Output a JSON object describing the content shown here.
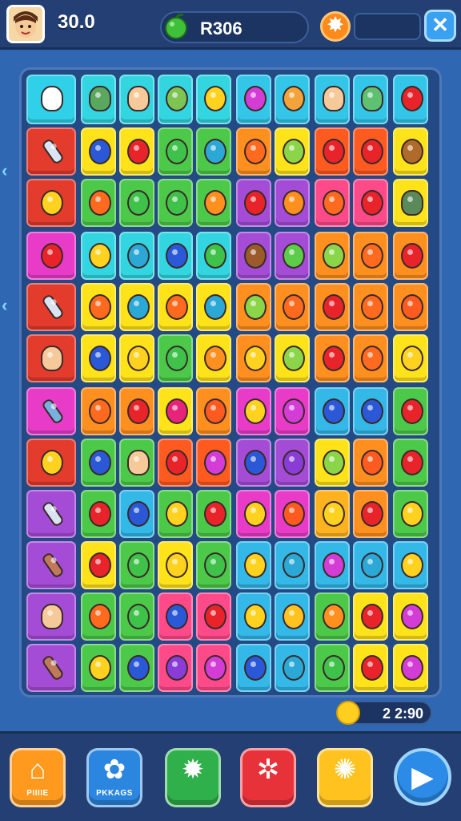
{
  "header": {
    "score": "30.0",
    "gem_label": "R306",
    "coin_symbol": "✸",
    "close_symbol": "✕"
  },
  "board": {
    "arrows": [
      "‹",
      "‹"
    ],
    "rows": [
      {
        "tiles": [
          {
            "bg": "#2fd0e8",
            "fruit": "#ffffff",
            "kind": "head"
          },
          {
            "bg": "#33d6e0",
            "fruit": "#5aa860",
            "kind": "head"
          },
          {
            "bg": "#33d6e0",
            "fruit": "#f6c99a",
            "kind": "head"
          },
          {
            "bg": "#33d6e0",
            "fruit": "#7cc453",
            "kind": "fruit"
          },
          {
            "bg": "#33d6e0",
            "fruit": "#ffd21f",
            "kind": "fruit"
          },
          {
            "bg": "#33c6e8",
            "fruit": "#d43cd6",
            "kind": "fruit"
          },
          {
            "bg": "#33c6e8",
            "fruit": "#f2a33a",
            "kind": "fruit"
          },
          {
            "bg": "#33c6e8",
            "fruit": "#f6c99a",
            "kind": "head"
          },
          {
            "bg": "#33c6e8",
            "fruit": "#5fc072",
            "kind": "head"
          },
          {
            "bg": "#33c6e8",
            "fruit": "#e8242a",
            "kind": "fruit"
          }
        ]
      },
      {
        "tiles": [
          {
            "bg": "#e33b2c",
            "fruit": "#d9e4f0",
            "kind": "tool"
          },
          {
            "bg": "#ffe31a",
            "fruit": "#2b58d6",
            "kind": "fruit"
          },
          {
            "bg": "#ffe31a",
            "fruit": "#e8242a",
            "kind": "fruit"
          },
          {
            "bg": "#4dc94a",
            "fruit": "#3fc24a",
            "kind": "fruit"
          },
          {
            "bg": "#4dc94a",
            "fruit": "#2ba8d6",
            "kind": "fruit"
          },
          {
            "bg": "#ff8f1f",
            "fruit": "#ff6a1f",
            "kind": "fruit"
          },
          {
            "bg": "#ffe31a",
            "fruit": "#8ad648",
            "kind": "fruit"
          },
          {
            "bg": "#ff5a1f",
            "fruit": "#e8242a",
            "kind": "fruit"
          },
          {
            "bg": "#ff5a1f",
            "fruit": "#e8242a",
            "kind": "fruit"
          },
          {
            "bg": "#ffe31a",
            "fruit": "#b06a2a",
            "kind": "fruit"
          }
        ]
      },
      {
        "tiles": [
          {
            "bg": "#e33b2c",
            "fruit": "#ffd21f",
            "kind": "fruit"
          },
          {
            "bg": "#4dc94a",
            "fruit": "#ff6a1f",
            "kind": "fruit"
          },
          {
            "bg": "#4dc94a",
            "fruit": "#3fc24a",
            "kind": "fruit"
          },
          {
            "bg": "#4dc94a",
            "fruit": "#3fc24a",
            "kind": "fruit"
          },
          {
            "bg": "#4dc94a",
            "fruit": "#ff8f1f",
            "kind": "fruit"
          },
          {
            "bg": "#a54cd6",
            "fruit": "#e8242a",
            "kind": "fruit"
          },
          {
            "bg": "#a54cd6",
            "fruit": "#ff8f1f",
            "kind": "fruit"
          },
          {
            "bg": "#ff4a8a",
            "fruit": "#ff6a1f",
            "kind": "fruit"
          },
          {
            "bg": "#ff4a8a",
            "fruit": "#e8242a",
            "kind": "fruit"
          },
          {
            "bg": "#ffe31a",
            "fruit": "#5a8a5a",
            "kind": "head"
          }
        ]
      },
      {
        "tiles": [
          {
            "bg": "#e83cc8",
            "fruit": "#e8242a",
            "kind": "fruit"
          },
          {
            "bg": "#33d6e0",
            "fruit": "#ffd21f",
            "kind": "fruit"
          },
          {
            "bg": "#33d6e0",
            "fruit": "#2ba8d6",
            "kind": "fruit"
          },
          {
            "bg": "#33d6e0",
            "fruit": "#2b58d6",
            "kind": "fruit"
          },
          {
            "bg": "#33d6e0",
            "fruit": "#3fc24a",
            "kind": "fruit"
          },
          {
            "bg": "#a54cd6",
            "fruit": "#9a5a2a",
            "kind": "fruit"
          },
          {
            "bg": "#a54cd6",
            "fruit": "#5ccc4a",
            "kind": "fruit"
          },
          {
            "bg": "#ff8f1f",
            "fruit": "#8ad648",
            "kind": "fruit"
          },
          {
            "bg": "#ff8f1f",
            "fruit": "#ff6a1f",
            "kind": "fruit"
          },
          {
            "bg": "#ff8f1f",
            "fruit": "#e8242a",
            "kind": "fruit"
          }
        ]
      },
      {
        "tiles": [
          {
            "bg": "#e33b2c",
            "fruit": "#d9e4f0",
            "kind": "tool"
          },
          {
            "bg": "#ffe31a",
            "fruit": "#ff6a1f",
            "kind": "fruit"
          },
          {
            "bg": "#ffe31a",
            "fruit": "#2ba8d6",
            "kind": "fruit"
          },
          {
            "bg": "#ffe31a",
            "fruit": "#ff6a1f",
            "kind": "fruit"
          },
          {
            "bg": "#ffe31a",
            "fruit": "#2ba8d6",
            "kind": "fruit"
          },
          {
            "bg": "#ff8f1f",
            "fruit": "#8ad648",
            "kind": "fruit"
          },
          {
            "bg": "#ff8f1f",
            "fruit": "#ff6a1f",
            "kind": "fruit"
          },
          {
            "bg": "#ff8f1f",
            "fruit": "#e8242a",
            "kind": "fruit"
          },
          {
            "bg": "#ff8f1f",
            "fruit": "#ff6a1f",
            "kind": "fruit"
          },
          {
            "bg": "#ff8f1f",
            "fruit": "#ff5a1f",
            "kind": "fruit"
          }
        ]
      },
      {
        "tiles": [
          {
            "bg": "#e33b2c",
            "fruit": "#f6c99a",
            "kind": "head"
          },
          {
            "bg": "#ffe31a",
            "fruit": "#2b58d6",
            "kind": "fruit"
          },
          {
            "bg": "#ffe31a",
            "fruit": "#ffd21f",
            "kind": "fruit"
          },
          {
            "bg": "#4dc94a",
            "fruit": "#3fc24a",
            "kind": "fruit"
          },
          {
            "bg": "#ffe31a",
            "fruit": "#ff8f1f",
            "kind": "fruit"
          },
          {
            "bg": "#ff8f1f",
            "fruit": "#ffd21f",
            "kind": "fruit"
          },
          {
            "bg": "#ffe31a",
            "fruit": "#8ad648",
            "kind": "fruit"
          },
          {
            "bg": "#ff8f1f",
            "fruit": "#e8242a",
            "kind": "fruit"
          },
          {
            "bg": "#ff8f1f",
            "fruit": "#ff6a1f",
            "kind": "fruit"
          },
          {
            "bg": "#ffe31a",
            "fruit": "#ffd21f",
            "kind": "fruit"
          }
        ]
      },
      {
        "tiles": [
          {
            "bg": "#e83cc8",
            "fruit": "#7ab0e0",
            "kind": "tool"
          },
          {
            "bg": "#ff8f1f",
            "fruit": "#ff6a1f",
            "kind": "fruit"
          },
          {
            "bg": "#ff8f1f",
            "fruit": "#e8242a",
            "kind": "fruit"
          },
          {
            "bg": "#ffe31a",
            "fruit": "#e8247a",
            "kind": "fruit"
          },
          {
            "bg": "#ff8f1f",
            "fruit": "#ff5a1f",
            "kind": "fruit"
          },
          {
            "bg": "#e83cc8",
            "fruit": "#ffd21f",
            "kind": "fruit"
          },
          {
            "bg": "#e83cc8",
            "fruit": "#d43cd6",
            "kind": "fruit"
          },
          {
            "bg": "#33b8e8",
            "fruit": "#2b58d6",
            "kind": "fruit"
          },
          {
            "bg": "#33b8e8",
            "fruit": "#2b58d6",
            "kind": "fruit"
          },
          {
            "bg": "#4dc94a",
            "fruit": "#e8242a",
            "kind": "fruit"
          }
        ]
      },
      {
        "tiles": [
          {
            "bg": "#e33b2c",
            "fruit": "#ffd21f",
            "kind": "fruit"
          },
          {
            "bg": "#4dc94a",
            "fruit": "#2b58d6",
            "kind": "fruit"
          },
          {
            "bg": "#4dc94a",
            "fruit": "#f6c99a",
            "kind": "head"
          },
          {
            "bg": "#ff5a1f",
            "fruit": "#e8242a",
            "kind": "fruit"
          },
          {
            "bg": "#ff5a1f",
            "fruit": "#d43cd6",
            "kind": "fruit"
          },
          {
            "bg": "#a54cd6",
            "fruit": "#2b58d6",
            "kind": "fruit"
          },
          {
            "bg": "#a54cd6",
            "fruit": "#8a3cd6",
            "kind": "fruit"
          },
          {
            "bg": "#ffe31a",
            "fruit": "#8ad648",
            "kind": "fruit"
          },
          {
            "bg": "#ff8f1f",
            "fruit": "#ff5a1f",
            "kind": "fruit"
          },
          {
            "bg": "#4dc94a",
            "fruit": "#e8242a",
            "kind": "fruit"
          }
        ]
      },
      {
        "tiles": [
          {
            "bg": "#a54cd6",
            "fruit": "#d9e4f0",
            "kind": "tool"
          },
          {
            "bg": "#4dc94a",
            "fruit": "#e8242a",
            "kind": "fruit"
          },
          {
            "bg": "#33b8e8",
            "fruit": "#2b58d6",
            "kind": "fruit"
          },
          {
            "bg": "#4dc94a",
            "fruit": "#ffd21f",
            "kind": "fruit"
          },
          {
            "bg": "#4dc94a",
            "fruit": "#e8242a",
            "kind": "fruit"
          },
          {
            "bg": "#e83cc8",
            "fruit": "#ffd21f",
            "kind": "fruit"
          },
          {
            "bg": "#e83cc8",
            "fruit": "#ff5a1f",
            "kind": "fruit"
          },
          {
            "bg": "#ffb21f",
            "fruit": "#ffd21f",
            "kind": "fruit"
          },
          {
            "bg": "#ff8f1f",
            "fruit": "#e8242a",
            "kind": "fruit"
          },
          {
            "bg": "#4dc94a",
            "fruit": "#ffd21f",
            "kind": "fruit"
          }
        ]
      },
      {
        "tiles": [
          {
            "bg": "#a54cd6",
            "fruit": "#c07a5a",
            "kind": "tool"
          },
          {
            "bg": "#ffe31a",
            "fruit": "#e8242a",
            "kind": "fruit"
          },
          {
            "bg": "#4dc94a",
            "fruit": "#3fc24a",
            "kind": "fruit"
          },
          {
            "bg": "#ffe31a",
            "fruit": "#ffd21f",
            "kind": "fruit"
          },
          {
            "bg": "#4dc94a",
            "fruit": "#3fc24a",
            "kind": "fruit"
          },
          {
            "bg": "#33b8e8",
            "fruit": "#ffd21f",
            "kind": "fruit"
          },
          {
            "bg": "#33b8e8",
            "fruit": "#2ba8d6",
            "kind": "fruit"
          },
          {
            "bg": "#33b8e8",
            "fruit": "#d43cd6",
            "kind": "fruit"
          },
          {
            "bg": "#33b8e8",
            "fruit": "#2ba8d6",
            "kind": "fruit"
          },
          {
            "bg": "#33b8e8",
            "fruit": "#ffd21f",
            "kind": "fruit"
          }
        ]
      },
      {
        "tiles": [
          {
            "bg": "#a54cd6",
            "fruit": "#f6c99a",
            "kind": "head"
          },
          {
            "bg": "#4dc94a",
            "fruit": "#ff6a1f",
            "kind": "fruit"
          },
          {
            "bg": "#4dc94a",
            "fruit": "#3fc24a",
            "kind": "fruit"
          },
          {
            "bg": "#ff4a8a",
            "fruit": "#2b58d6",
            "kind": "fruit"
          },
          {
            "bg": "#ff4a8a",
            "fruit": "#e8242a",
            "kind": "fruit"
          },
          {
            "bg": "#33b8e8",
            "fruit": "#ffd21f",
            "kind": "fruit"
          },
          {
            "bg": "#33b8e8",
            "fruit": "#ffc21f",
            "kind": "fruit"
          },
          {
            "bg": "#4dc94a",
            "fruit": "#ff8f1f",
            "kind": "fruit"
          },
          {
            "bg": "#ffe31a",
            "fruit": "#e8242a",
            "kind": "fruit"
          },
          {
            "bg": "#ffe31a",
            "fruit": "#d43cd6",
            "kind": "fruit"
          }
        ]
      },
      {
        "tiles": [
          {
            "bg": "#a54cd6",
            "fruit": "#c07a5a",
            "kind": "tool"
          },
          {
            "bg": "#4dc94a",
            "fruit": "#ffd21f",
            "kind": "fruit"
          },
          {
            "bg": "#4dc94a",
            "fruit": "#2b58d6",
            "kind": "fruit"
          },
          {
            "bg": "#ff4a8a",
            "fruit": "#8a3cd6",
            "kind": "fruit"
          },
          {
            "bg": "#ff4a8a",
            "fruit": "#d43cd6",
            "kind": "fruit"
          },
          {
            "bg": "#33b8e8",
            "fruit": "#2b58d6",
            "kind": "fruit"
          },
          {
            "bg": "#33b8e8",
            "fruit": "#2ba8d6",
            "kind": "fruit"
          },
          {
            "bg": "#4dc94a",
            "fruit": "#3fc24a",
            "kind": "fruit"
          },
          {
            "bg": "#ffe31a",
            "fruit": "#e8242a",
            "kind": "fruit"
          },
          {
            "bg": "#ffe31a",
            "fruit": "#d43cd6",
            "kind": "fruit"
          }
        ]
      }
    ]
  },
  "timer": {
    "label": "2 2:90"
  },
  "bottom": {
    "buttons": [
      {
        "label": "PIIIIE",
        "icon": "⌂",
        "color": "#ff9a1f"
      },
      {
        "label": "PKKAGS",
        "icon": "✿",
        "color": "#2b86e0"
      },
      {
        "label": "",
        "icon": "✹",
        "color": "#2fb04a"
      },
      {
        "label": "",
        "icon": "✲",
        "color": "#e8323a"
      },
      {
        "label": "",
        "icon": "✺",
        "color": "#ffc21f"
      }
    ],
    "play_icon": "▶"
  }
}
